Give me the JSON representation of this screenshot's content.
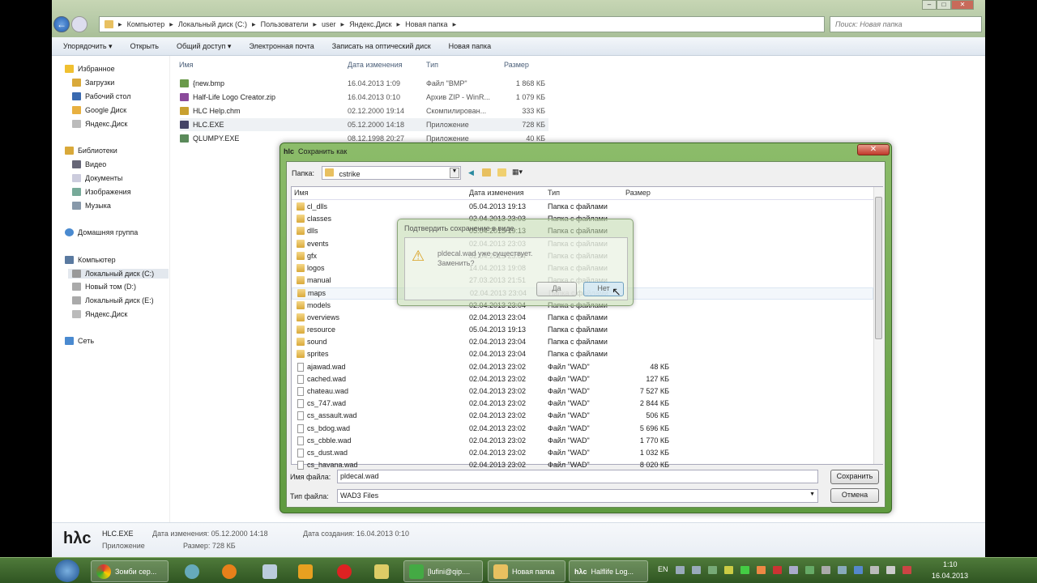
{
  "explorer": {
    "breadcrumb": [
      "Компьютер",
      "Локальный диск (C:)",
      "Пользователи",
      "user",
      "Яндекс.Диск",
      "Новая папка"
    ],
    "search_placeholder": "Поиск: Новая папка",
    "toolbar": [
      "Упорядочить ▾",
      "Открыть",
      "Общий доступ ▾",
      "Электронная почта",
      "Записать на оптический диск",
      "Новая папка"
    ],
    "sidebar": {
      "favorites": "Избранное",
      "fav_items": [
        "Загрузки",
        "Рабочий стол",
        "Google Диск",
        "Яндекс.Диск"
      ],
      "libraries": "Библиотеки",
      "lib_items": [
        "Видео",
        "Документы",
        "Изображения",
        "Музыка"
      ],
      "homegroup": "Домашняя группа",
      "computer": "Компьютер",
      "comp_items": [
        "Локальный диск (C:)",
        "Новый том (D:)",
        "Локальный диск (E:)",
        "Яндекс.Диск"
      ],
      "network": "Сеть"
    },
    "columns": [
      "Имя",
      "Дата изменения",
      "Тип",
      "Размер"
    ],
    "files": [
      {
        "name": "{new.bmp",
        "date": "16.04.2013 1:09",
        "type": "Файл \"BMP\"",
        "size": "1 868 КБ"
      },
      {
        "name": "Half-Life Logo Creator.zip",
        "date": "16.04.2013 0:10",
        "type": "Архив ZIP - WinR...",
        "size": "1 079 КБ"
      },
      {
        "name": "HLC Help.chm",
        "date": "02.12.2000 19:14",
        "type": "Скомпилирован...",
        "size": "333 КБ"
      },
      {
        "name": "HLC.EXE",
        "date": "05.12.2000 14:18",
        "type": "Приложение",
        "size": "728 КБ"
      },
      {
        "name": "QLUMPY.EXE",
        "date": "08.12.1998 20:27",
        "type": "Приложение",
        "size": "40 КБ"
      }
    ],
    "details": {
      "logo": "hλc",
      "name": "HLC.EXE",
      "type": "Приложение",
      "modified_label": "Дата изменения: 05.12.2000 14:18",
      "size_label": "Размер: 728 КБ",
      "created_label": "Дата создания: 16.04.2013 0:10"
    }
  },
  "save_dialog": {
    "title": "Сохранить как",
    "title_logo": "hlc",
    "folder_label": "Папка:",
    "folder": "cstrike",
    "columns": [
      "Имя",
      "Дата изменения",
      "Тип",
      "Размер"
    ],
    "rows": [
      {
        "name": "cl_dlls",
        "date": "05.04.2013 19:13",
        "type": "Папка с файлами",
        "size": "",
        "folder": true
      },
      {
        "name": "classes",
        "date": "02.04.2013 23:03",
        "type": "Папка с файлами",
        "size": "",
        "folder": true
      },
      {
        "name": "dlls",
        "date": "05.04.2013 19:13",
        "type": "Папка с файлами",
        "size": "",
        "folder": true
      },
      {
        "name": "events",
        "date": "02.04.2013 23:03",
        "type": "Папка с файлами",
        "size": "",
        "folder": true
      },
      {
        "name": "gfx",
        "date": "02.04.2013 23:04",
        "type": "Папка с файлами",
        "size": "",
        "folder": true
      },
      {
        "name": "logos",
        "date": "14.04.2013 19:08",
        "type": "Папка с файлами",
        "size": "",
        "folder": true
      },
      {
        "name": "manual",
        "date": "27.03.2013 21:51",
        "type": "Папка с файлами",
        "size": "",
        "folder": true
      },
      {
        "name": "maps",
        "date": "02.04.2013 23:04",
        "type": "Папка с файлами",
        "size": "",
        "folder": true
      },
      {
        "name": "models",
        "date": "02.04.2013 23:04",
        "type": "Папка с файлами",
        "size": "",
        "folder": true
      },
      {
        "name": "overviews",
        "date": "02.04.2013 23:04",
        "type": "Папка с файлами",
        "size": "",
        "folder": true
      },
      {
        "name": "resource",
        "date": "05.04.2013 19:13",
        "type": "Папка с файлами",
        "size": "",
        "folder": true
      },
      {
        "name": "sound",
        "date": "02.04.2013 23:04",
        "type": "Папка с файлами",
        "size": "",
        "folder": true
      },
      {
        "name": "sprites",
        "date": "02.04.2013 23:04",
        "type": "Папка с файлами",
        "size": "",
        "folder": true
      },
      {
        "name": "ajawad.wad",
        "date": "02.04.2013 23:02",
        "type": "Файл \"WAD\"",
        "size": "48 КБ",
        "folder": false
      },
      {
        "name": "cached.wad",
        "date": "02.04.2013 23:02",
        "type": "Файл \"WAD\"",
        "size": "127 КБ",
        "folder": false
      },
      {
        "name": "chateau.wad",
        "date": "02.04.2013 23:02",
        "type": "Файл \"WAD\"",
        "size": "7 527 КБ",
        "folder": false
      },
      {
        "name": "cs_747.wad",
        "date": "02.04.2013 23:02",
        "type": "Файл \"WAD\"",
        "size": "2 844 КБ",
        "folder": false
      },
      {
        "name": "cs_assault.wad",
        "date": "02.04.2013 23:02",
        "type": "Файл \"WAD\"",
        "size": "506 КБ",
        "folder": false
      },
      {
        "name": "cs_bdog.wad",
        "date": "02.04.2013 23:02",
        "type": "Файл \"WAD\"",
        "size": "5 696 КБ",
        "folder": false
      },
      {
        "name": "cs_cbble.wad",
        "date": "02.04.2013 23:02",
        "type": "Файл \"WAD\"",
        "size": "1 770 КБ",
        "folder": false
      },
      {
        "name": "cs_dust.wad",
        "date": "02.04.2013 23:02",
        "type": "Файл \"WAD\"",
        "size": "1 032 КБ",
        "folder": false
      },
      {
        "name": "cs_havana.wad",
        "date": "02.04.2013 23:02",
        "type": "Файл \"WAD\"",
        "size": "8 020 КБ",
        "folder": false
      }
    ],
    "filename_label": "Имя файла:",
    "filename": "pldecal.wad",
    "filetype_label": "Тип файла:",
    "filetype": "WAD3 Files",
    "save": "Сохранить",
    "cancel": "Отмена"
  },
  "confirm": {
    "title": "Подтвердить сохранение в виде",
    "message": "pldecal.wad уже существует.",
    "question": "Заменить?",
    "yes": "Да",
    "no": "Нет"
  },
  "taskbar": {
    "items": [
      "Зомби сер...",
      "[lufini@qip....",
      "Новая папка",
      "Halflife Log..."
    ],
    "lang": "EN",
    "time": "1:10",
    "date": "16.04.2013"
  }
}
